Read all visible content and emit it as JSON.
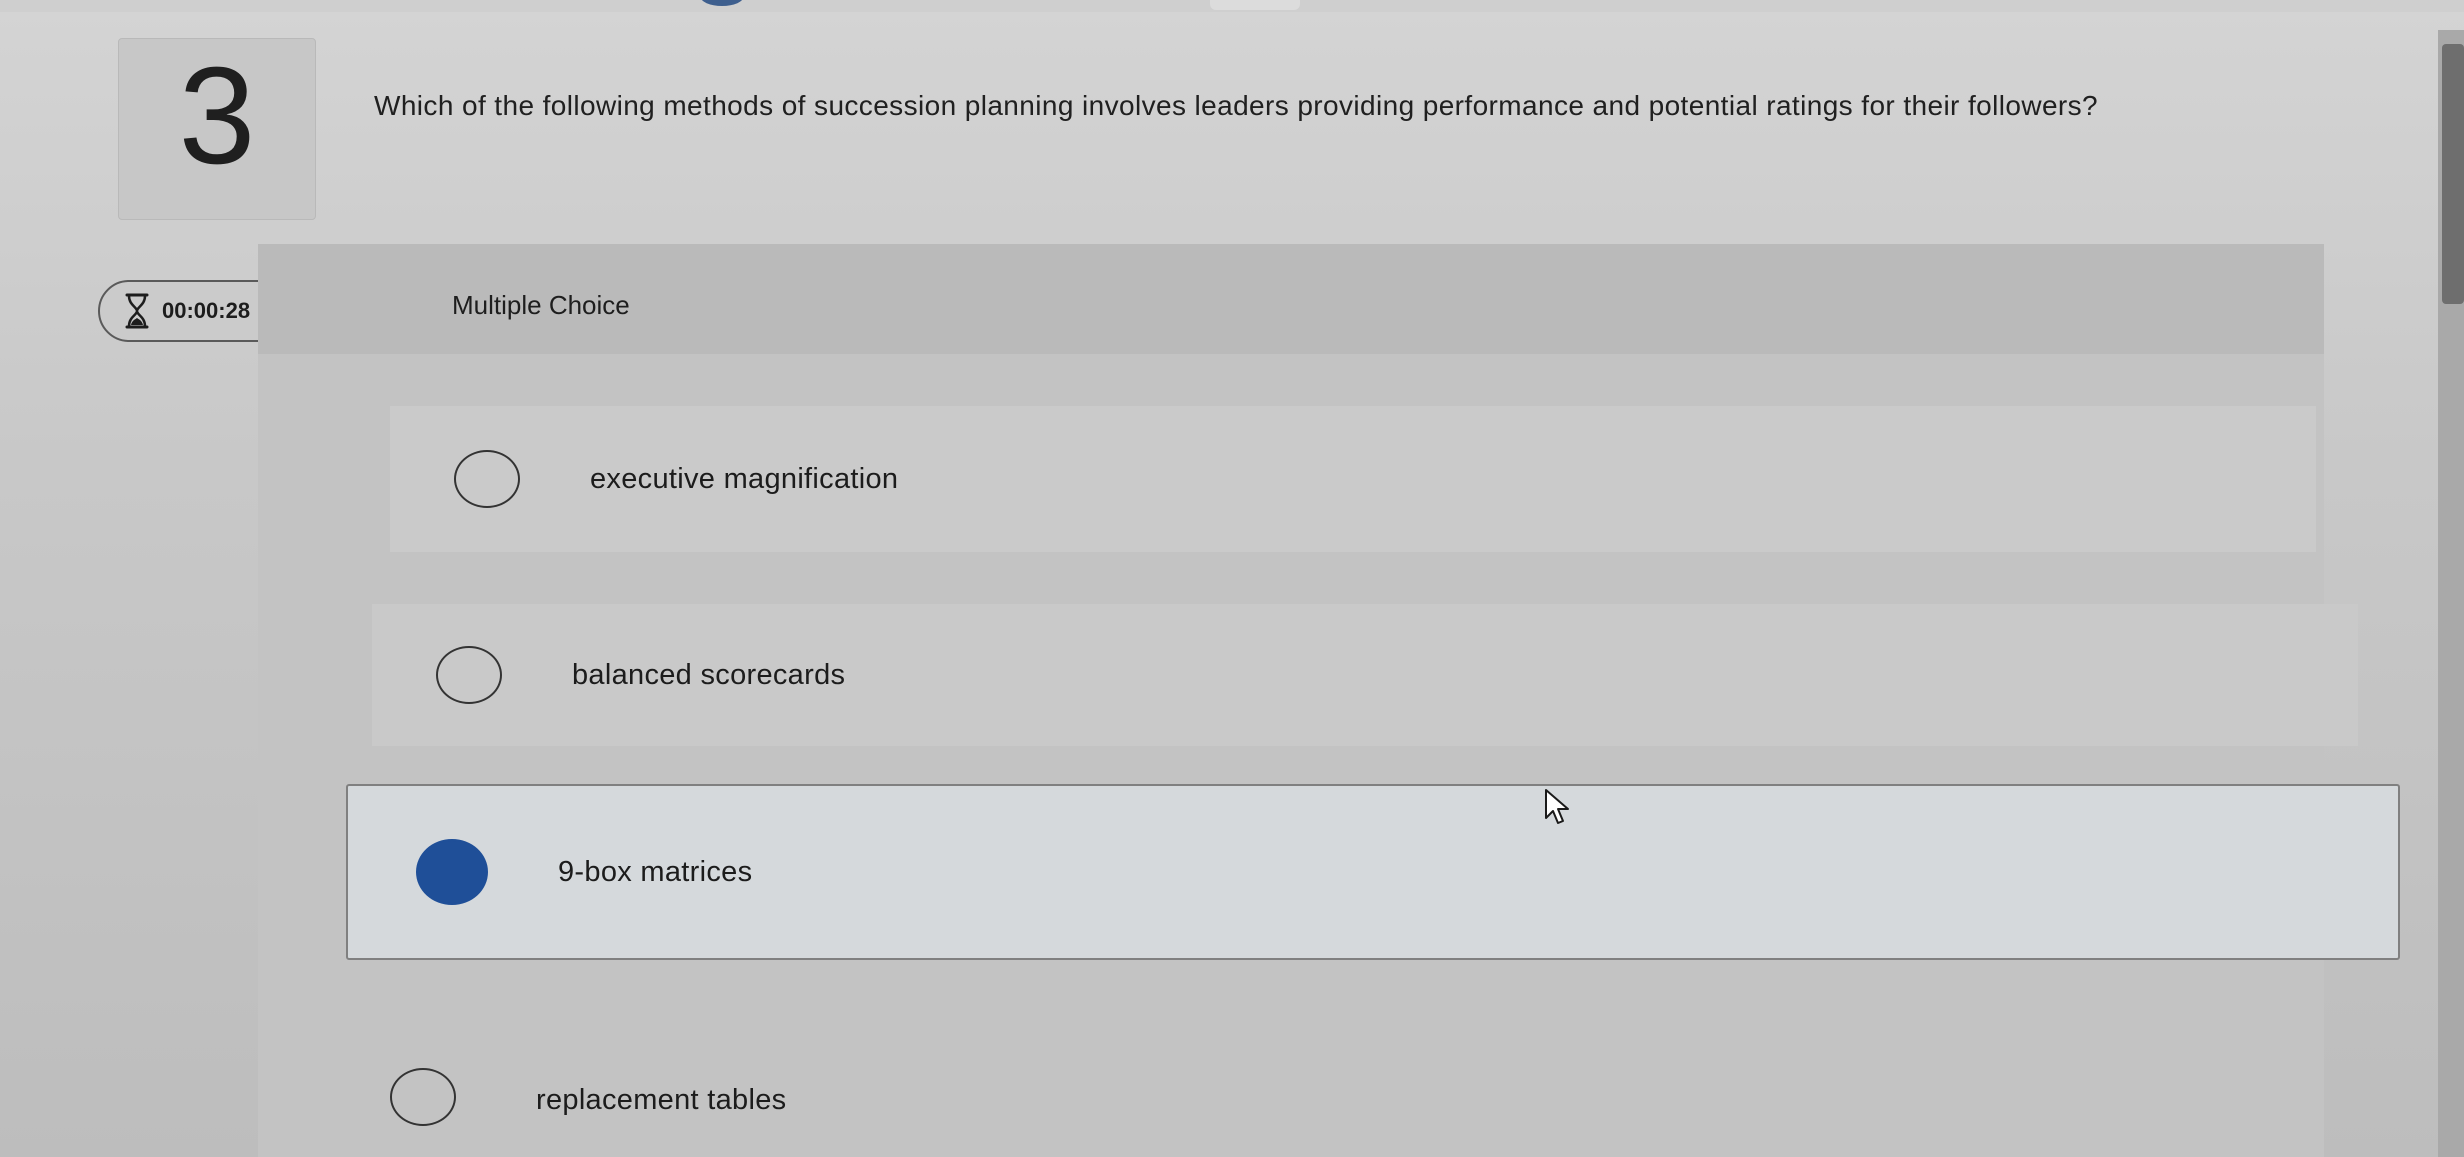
{
  "question": {
    "number": "3",
    "text": "Which of the following methods of succession planning involves leaders providing performance and potential ratings for their followers?"
  },
  "timer": {
    "icon": "hourglass-icon",
    "value": "00:00:28"
  },
  "question_type": "Multiple Choice",
  "options": [
    {
      "label": "executive magnification",
      "selected": false
    },
    {
      "label": "balanced scorecards",
      "selected": false
    },
    {
      "label": "9-box matrices",
      "selected": true
    },
    {
      "label": "replacement tables",
      "selected": false
    }
  ],
  "colors": {
    "selected_radio": "#1f4f98",
    "selected_option_bg": "#d5d9dc"
  }
}
